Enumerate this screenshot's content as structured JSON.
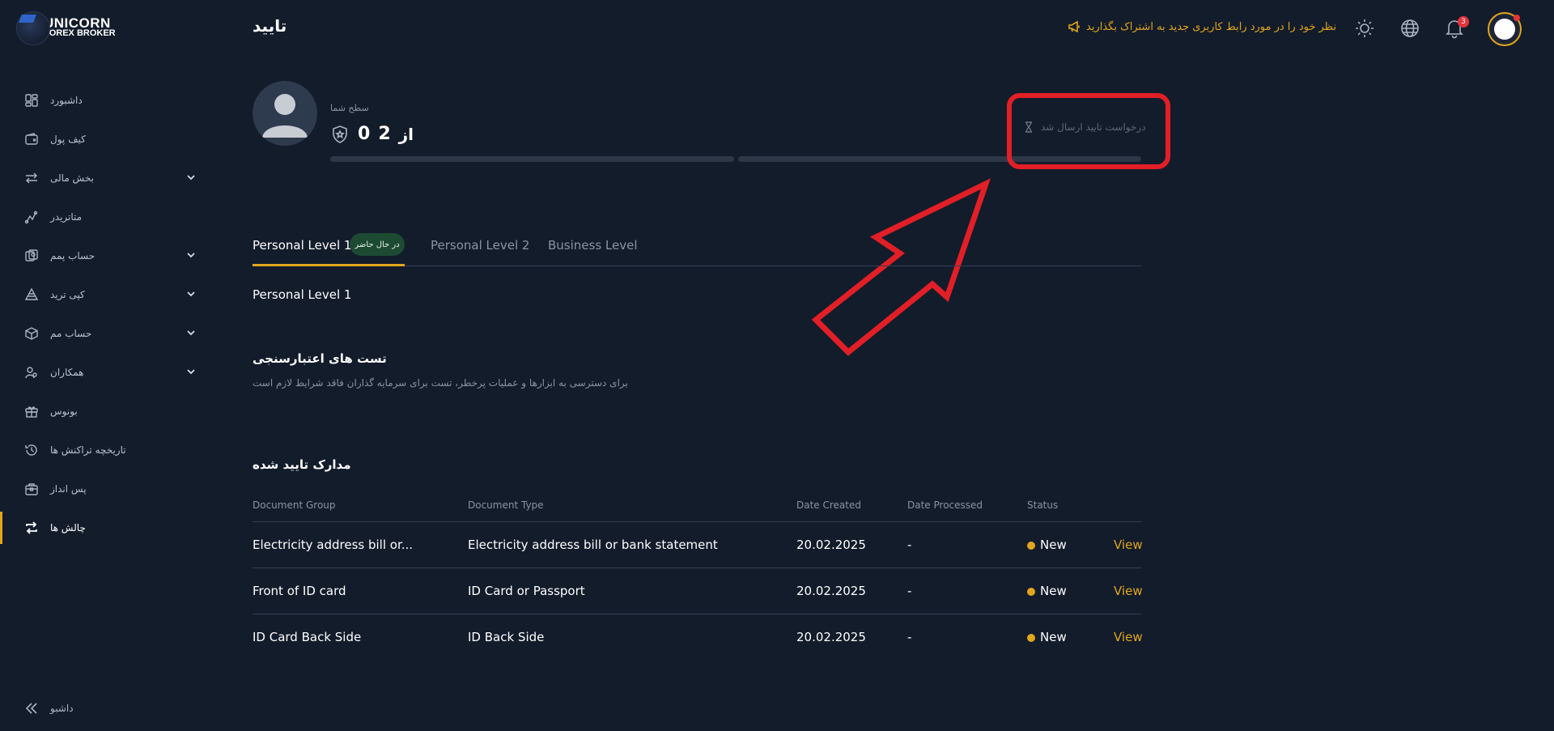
{
  "brand": {
    "name": "UNICORN",
    "subtitle": "FOREX BROKER"
  },
  "sidebar": {
    "items": [
      {
        "label": "داشبورد",
        "icon": "dashboard-icon",
        "expandable": false
      },
      {
        "label": "کیف پول",
        "icon": "wallet-icon",
        "expandable": false
      },
      {
        "label": "بخش مالی",
        "icon": "transfer-icon",
        "expandable": true
      },
      {
        "label": "متاتریدر",
        "icon": "metatrader-icon",
        "expandable": false
      },
      {
        "label": "حساب پمم",
        "icon": "pamm-icon",
        "expandable": true
      },
      {
        "label": "کپی ترید",
        "icon": "copy-trade-icon",
        "expandable": true
      },
      {
        "label": "حساب مم",
        "icon": "box-icon",
        "expandable": true
      },
      {
        "label": "همکاران",
        "icon": "partners-icon",
        "expandable": true
      },
      {
        "label": "بونوس",
        "icon": "gift-icon",
        "expandable": false
      },
      {
        "label": "تاریخچه تراکنش ها",
        "icon": "history-icon",
        "expandable": false
      },
      {
        "label": "پس انداز",
        "icon": "savings-icon",
        "expandable": false
      },
      {
        "label": "چالش ها",
        "icon": "challenges-icon",
        "expandable": false,
        "active": true
      }
    ],
    "collapse_label": "داشبو"
  },
  "header": {
    "title": "تایید",
    "feedback_text": "نظر خود را در مورد رابط کاربری جدید به اشتراک بگذارید",
    "notification_count": "3"
  },
  "level": {
    "label": "سطح شما",
    "current": "0",
    "total": "2",
    "of_text": "از",
    "pending_text": "درخواست تایید ارسال شد"
  },
  "tabs": [
    {
      "label": "Personal Level 1",
      "badge": "در حال حاضر",
      "active": true
    },
    {
      "label": "Personal Level 2",
      "active": false
    },
    {
      "label": "Business Level",
      "active": false
    }
  ],
  "section_title": "Personal Level 1",
  "tests": {
    "title": "تست های اعتبارسنجی",
    "subtitle": "برای دسترسی به ابزارها و عملیات پرخطر، تست برای سرمایه گذاران فاقد شرایط لازم است"
  },
  "documents": {
    "title": "مدارک تایید شده",
    "columns": [
      "Document Group",
      "Document Type",
      "Date Created",
      "Date Processed",
      "Status"
    ],
    "rows": [
      {
        "group": "Electricity address bill or...",
        "type": "Electricity address bill or bank statement",
        "created": "20.02.2025",
        "processed": "-",
        "status": "New",
        "action": "View"
      },
      {
        "group": "Front of ID card",
        "type": "ID Card or Passport",
        "created": "20.02.2025",
        "processed": "-",
        "status": "New",
        "action": "View"
      },
      {
        "group": "ID Card Back Side",
        "type": "ID Back Side",
        "created": "20.02.2025",
        "processed": "-",
        "status": "New",
        "action": "View"
      }
    ]
  },
  "colors": {
    "accent": "#e2a61c",
    "background": "#131c2b",
    "annotation": "#e21f26",
    "badge_green": "#1d4a33"
  }
}
